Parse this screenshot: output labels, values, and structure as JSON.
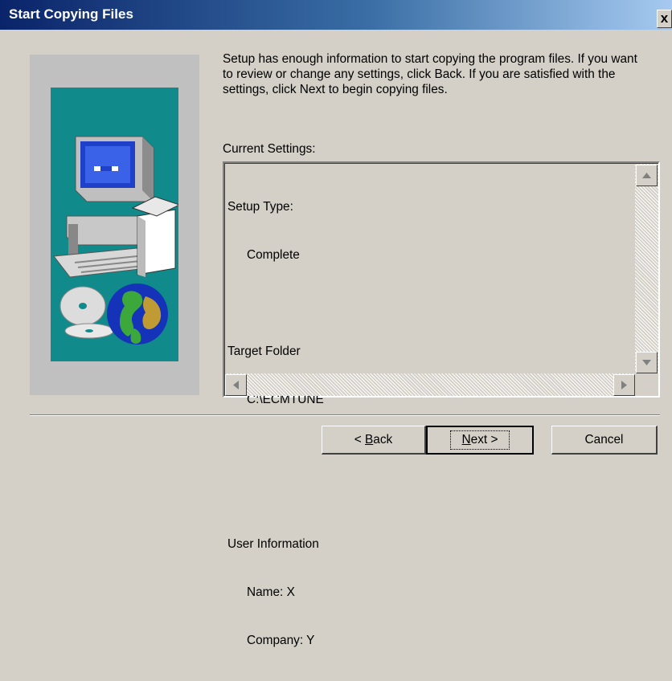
{
  "window": {
    "title": "Start Copying Files",
    "close_label": "x"
  },
  "intro_text": "Setup has enough information to start copying the program files.  If you want to review or change any settings, click Back.  If you are satisfied with the settings, click Next to begin copying files.",
  "current_settings_label": "Current Settings:",
  "settings": [
    {
      "heading": "Setup Type:",
      "values": [
        "Complete"
      ]
    },
    {
      "heading": "Target Folder",
      "values": [
        "C:\\ECMTUNE"
      ]
    },
    {
      "heading": "User Information",
      "values": [
        "Name: X",
        "Company: Y"
      ]
    }
  ],
  "buttons": {
    "back_prefix": "< ",
    "back_mnemonic": "B",
    "back_rest": "ack",
    "next_mnemonic": "N",
    "next_rest": "ext >",
    "cancel": "Cancel"
  },
  "colors": {
    "title_start": "#0a246a",
    "title_end": "#a6caf0",
    "dialog_bg": "#d4d0c8",
    "art_teal": "#108a8a"
  }
}
